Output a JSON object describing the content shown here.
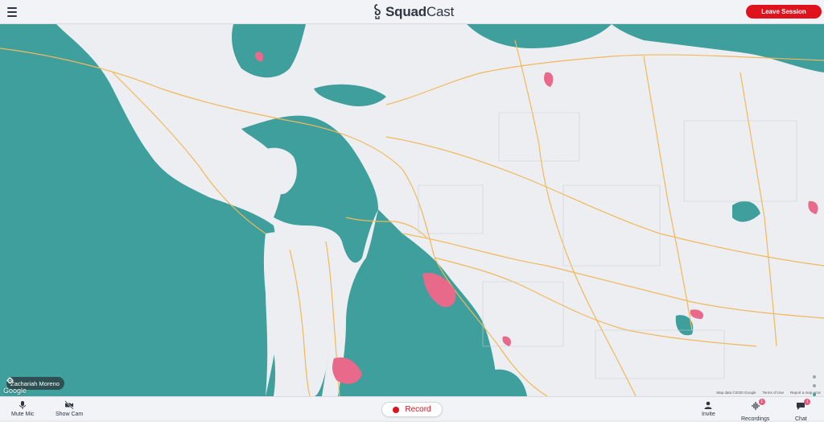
{
  "header": {
    "menu_icon": "hamburger-menu-icon",
    "logo_icon": "squadcast-logo-icon",
    "logo_bold": "Squad",
    "logo_rest": "Cast",
    "leave_label": "Leave Session"
  },
  "map": {
    "participant_name": "Zachariah Moreno",
    "participant_icon": "gear-icon",
    "google_label": "Google",
    "credits": [
      "Map data ©2020 Google",
      "Terms of Use",
      "Report a map error"
    ],
    "colors": {
      "water": "#3e9f9c",
      "land": "#eceef2",
      "highway": "#f2b85a",
      "urban": "#e8698a"
    }
  },
  "footer": {
    "mute_label": "Mute Mic",
    "cam_label": "Show Cam",
    "record_label": "Record",
    "invite_label": "Invite",
    "recordings_label": "Recordings",
    "recordings_count": "1",
    "chat_label": "Chat",
    "chat_count": "1"
  }
}
